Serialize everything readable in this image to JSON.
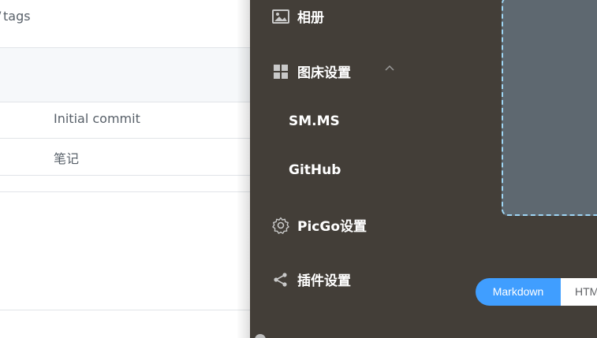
{
  "left": {
    "tags_text": "tags",
    "tags_glyph": "/",
    "commits": [
      {
        "message": "Initial commit"
      },
      {
        "message": "笔记"
      }
    ]
  },
  "sidebar": {
    "items": [
      {
        "label": "相册",
        "icon": "image-icon"
      },
      {
        "label": "图床设置",
        "icon": "grid-icon"
      },
      {
        "label": "PicGo设置",
        "icon": "gear-icon"
      },
      {
        "label": "插件设置",
        "icon": "share-icon"
      }
    ],
    "submenu": [
      {
        "label": "SM.MS"
      },
      {
        "label": "GitHub"
      }
    ]
  },
  "link_format": {
    "options": [
      {
        "label": "Markdown",
        "selected": true
      },
      {
        "label": "HTM"
      }
    ]
  },
  "colors": {
    "panel_bg": "#433e38",
    "accent": "#409eff",
    "upload_bg": "#5e6870",
    "upload_border": "#9fd6f5"
  }
}
